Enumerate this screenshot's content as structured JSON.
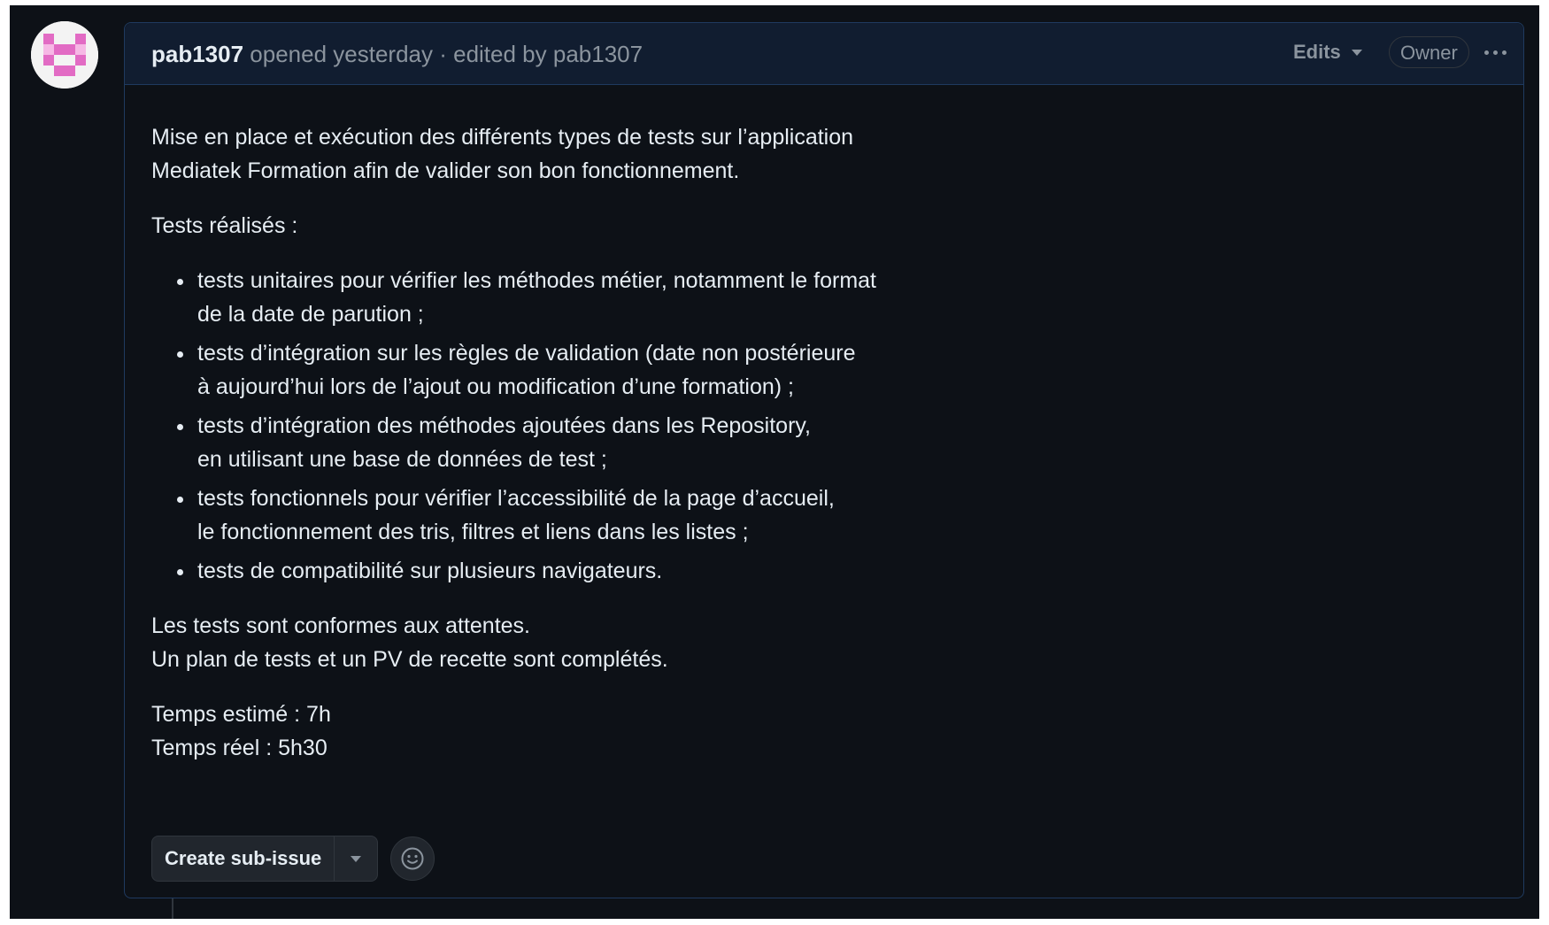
{
  "issue": {
    "author": "pab1307",
    "meta": " opened yesterday · edited by pab1307",
    "edits_label": "Edits",
    "owner_badge": "Owner",
    "intro": "Mise en place et exécution des différents types de tests sur l’application",
    "intro2": "Mediatek Formation afin de valider son bon fonctionnement.",
    "tests_heading": "Tests réalisés :",
    "tests": [
      {
        "line1": "tests unitaires pour vérifier les méthodes métier, notamment le format",
        "line2": "de la date de parution ;"
      },
      {
        "line1": "tests d’intégration sur les règles de validation (date non postérieure",
        "line2": "à aujourd’hui lors de l’ajout ou modification d’une formation) ;"
      },
      {
        "line1": "tests d’intégration des méthodes ajoutées dans les Repository,",
        "line2": "en utilisant une base de données de test ;"
      },
      {
        "line1": "tests fonctionnels pour vérifier l’accessibilité de la page d’accueil,",
        "line2": "le fonctionnement des tris, filtres et liens dans les listes ;"
      },
      {
        "line1": "tests de compatibilité sur plusieurs navigateurs.",
        "line2": ""
      }
    ],
    "conclusion1": "Les tests sont conformes aux attentes.",
    "conclusion2": "Un plan de tests et un PV de recette sont complétés.",
    "time_estimated": "Temps estimé : 7h",
    "time_real": "Temps réel : 5h30",
    "create_subissue_label": "Create sub-issue"
  },
  "icons": {
    "avatar": "identicon-avatar",
    "edits_dropdown": "chevron-down-icon",
    "more_options": "kebab-horizontal-icon",
    "subissue_dropdown": "triangle-down-icon",
    "reaction": "smiley-icon"
  },
  "colors": {
    "background": "#0d1117",
    "header_bg": "#111d30",
    "border_accent": "#1f3a5f",
    "text": "#e6edf3",
    "muted": "#8b949e",
    "avatar_accent": "#e26bc4"
  }
}
